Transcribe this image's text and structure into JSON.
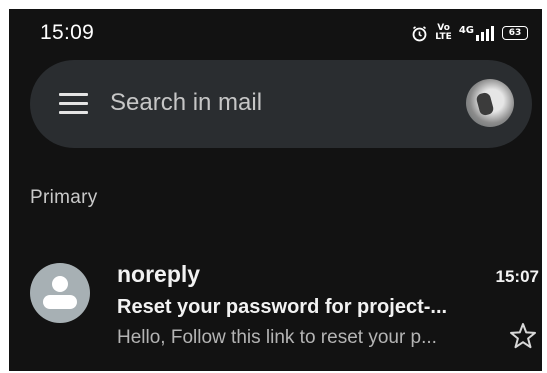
{
  "status_bar": {
    "time": "15:09",
    "volte_top": "Vo",
    "volte_bottom": "LTE",
    "network": "4G",
    "battery": "63"
  },
  "search": {
    "placeholder": "Search in mail"
  },
  "section": {
    "label": "Primary"
  },
  "mail_list": [
    {
      "sender": "noreply",
      "time": "15:07",
      "subject": "Reset your password for project-...",
      "snippet": "Hello, Follow this link to reset your p...",
      "starred": false
    }
  ],
  "colors": {
    "background": "#121212",
    "search_bar": "#2a2d30",
    "sender_avatar": "#a7b0b4",
    "primary_text": "#f2f2f2",
    "secondary_text": "#b4b4b4"
  }
}
